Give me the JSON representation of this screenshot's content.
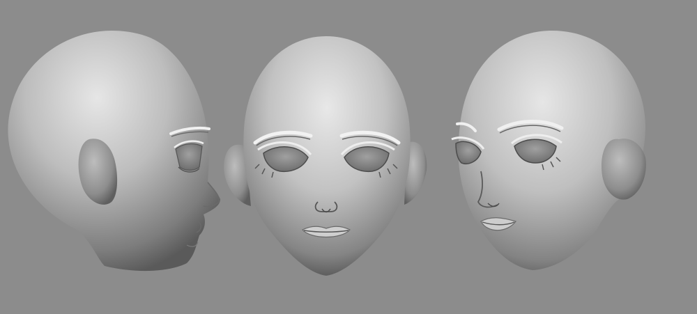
{
  "scene": {
    "background_color": "#8c8c8c",
    "material_light": "#e2e2e2",
    "material_mid": "#a9a9a9",
    "material_dark": "#4a4a4a",
    "views": [
      {
        "name": "side-profile-view"
      },
      {
        "name": "front-view"
      },
      {
        "name": "three-quarter-view"
      }
    ]
  }
}
